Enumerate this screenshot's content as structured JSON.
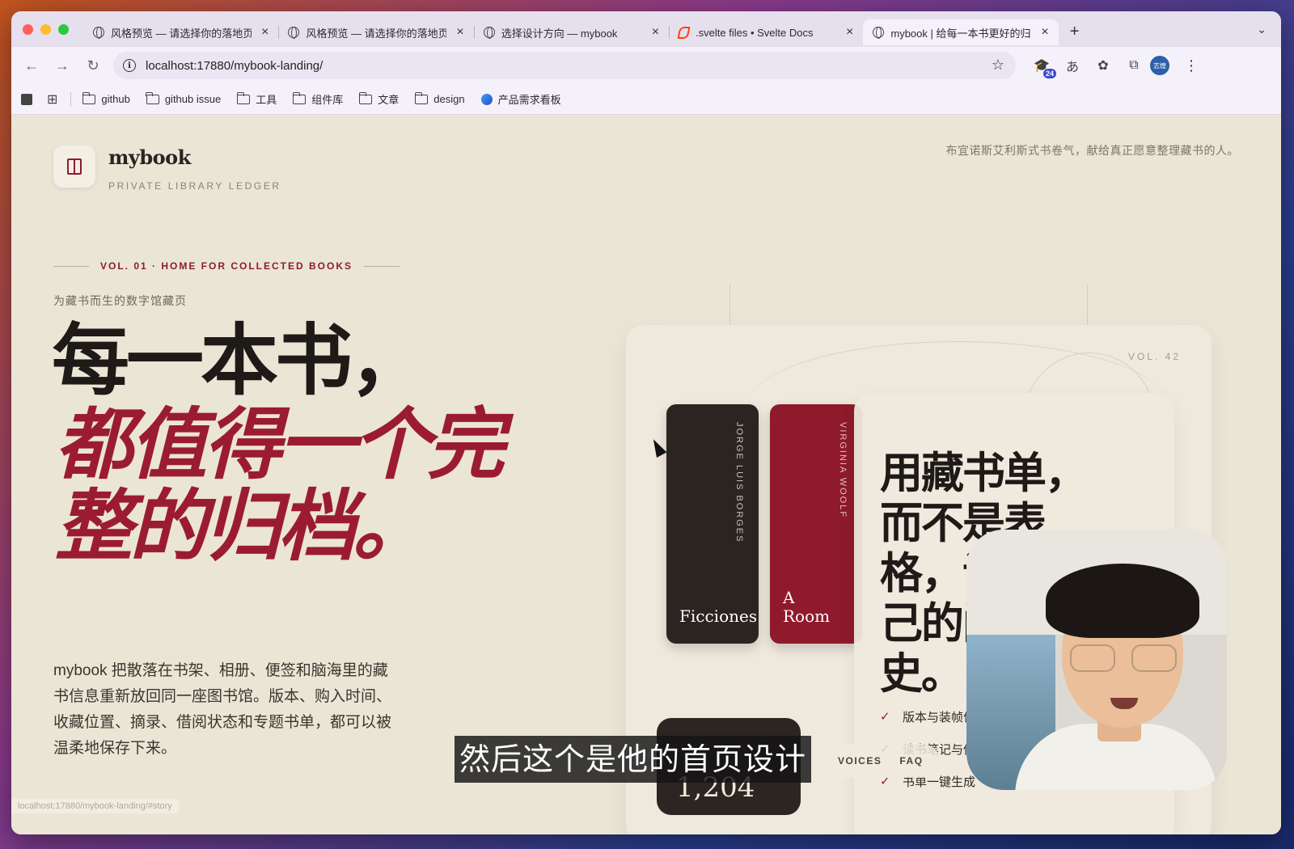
{
  "browser": {
    "tabs": [
      {
        "title": "风格预览 — 请选择你的落地页设",
        "icon": "globe-icon",
        "active": false
      },
      {
        "title": "风格预览 — 请选择你的落地页设",
        "icon": "globe-icon",
        "active": false
      },
      {
        "title": "选择设计方向 — mybook",
        "icon": "globe-icon",
        "active": false
      },
      {
        "title": ".svelte files • Svelte Docs",
        "icon": "svelte-icon",
        "active": false
      },
      {
        "title": "mybook | 给每一本书更好的归档",
        "icon": "globe-icon",
        "active": true
      }
    ],
    "url": "localhost:17880/mybook-landing/",
    "extension_badge": "24",
    "profile_label": "志煌",
    "bookmarks": [
      {
        "label": "github",
        "icon": "folder-icon"
      },
      {
        "label": "github issue",
        "icon": "folder-icon"
      },
      {
        "label": "工具",
        "icon": "folder-icon"
      },
      {
        "label": "组件库",
        "icon": "folder-icon"
      },
      {
        "label": "文章",
        "icon": "folder-icon"
      },
      {
        "label": "design",
        "icon": "folder-icon"
      },
      {
        "label": "产品需求看板",
        "icon": "board-icon"
      }
    ],
    "status_url": "localhost:17880/mybook-landing/#story"
  },
  "page": {
    "brand": "mybook",
    "brand_sub": "PRIVATE LIBRARY LEDGER",
    "tagline": "布宜诺斯艾利斯式书卷气，献给真正愿意整理藏书的人。",
    "vol_label": "VOL. 01 · HOME FOR COLLECTED BOOKS",
    "kicker": "为藏书而生的数字馆藏页",
    "headline_line1": "每一本书，",
    "headline_red": "都值得一个完整的归档。",
    "lede": "mybook 把散落在书架、相册、便签和脑海里的藏书信息重新放回同一座图书馆。版本、购入时间、收藏位置、摘录、借阅状态和专题书单，都可以被温柔地保存下来。",
    "card": {
      "vol": "VOL. 42",
      "spines": [
        {
          "author": "JORGE LUIS BORGES",
          "title": "Ficciones",
          "color": "#2b2420"
        },
        {
          "author": "VIRGINIA WOOLF",
          "title": "A Room",
          "color": "#8e1a2b"
        }
      ],
      "heading": "用藏书单，而不是表格，记录自己的阅读史。",
      "checks": [
        "版本与装帧信息",
        "读书笔记与借阅",
        "书单一键生成"
      ],
      "stat": "1,204"
    },
    "mini_nav": [
      "VOICES",
      "FAQ"
    ],
    "colors": {
      "accent": "#9b1c30",
      "ink": "#1e1a17",
      "paper": "#ebe5d6"
    }
  },
  "subtitle": "然后这个是他的首页设计"
}
